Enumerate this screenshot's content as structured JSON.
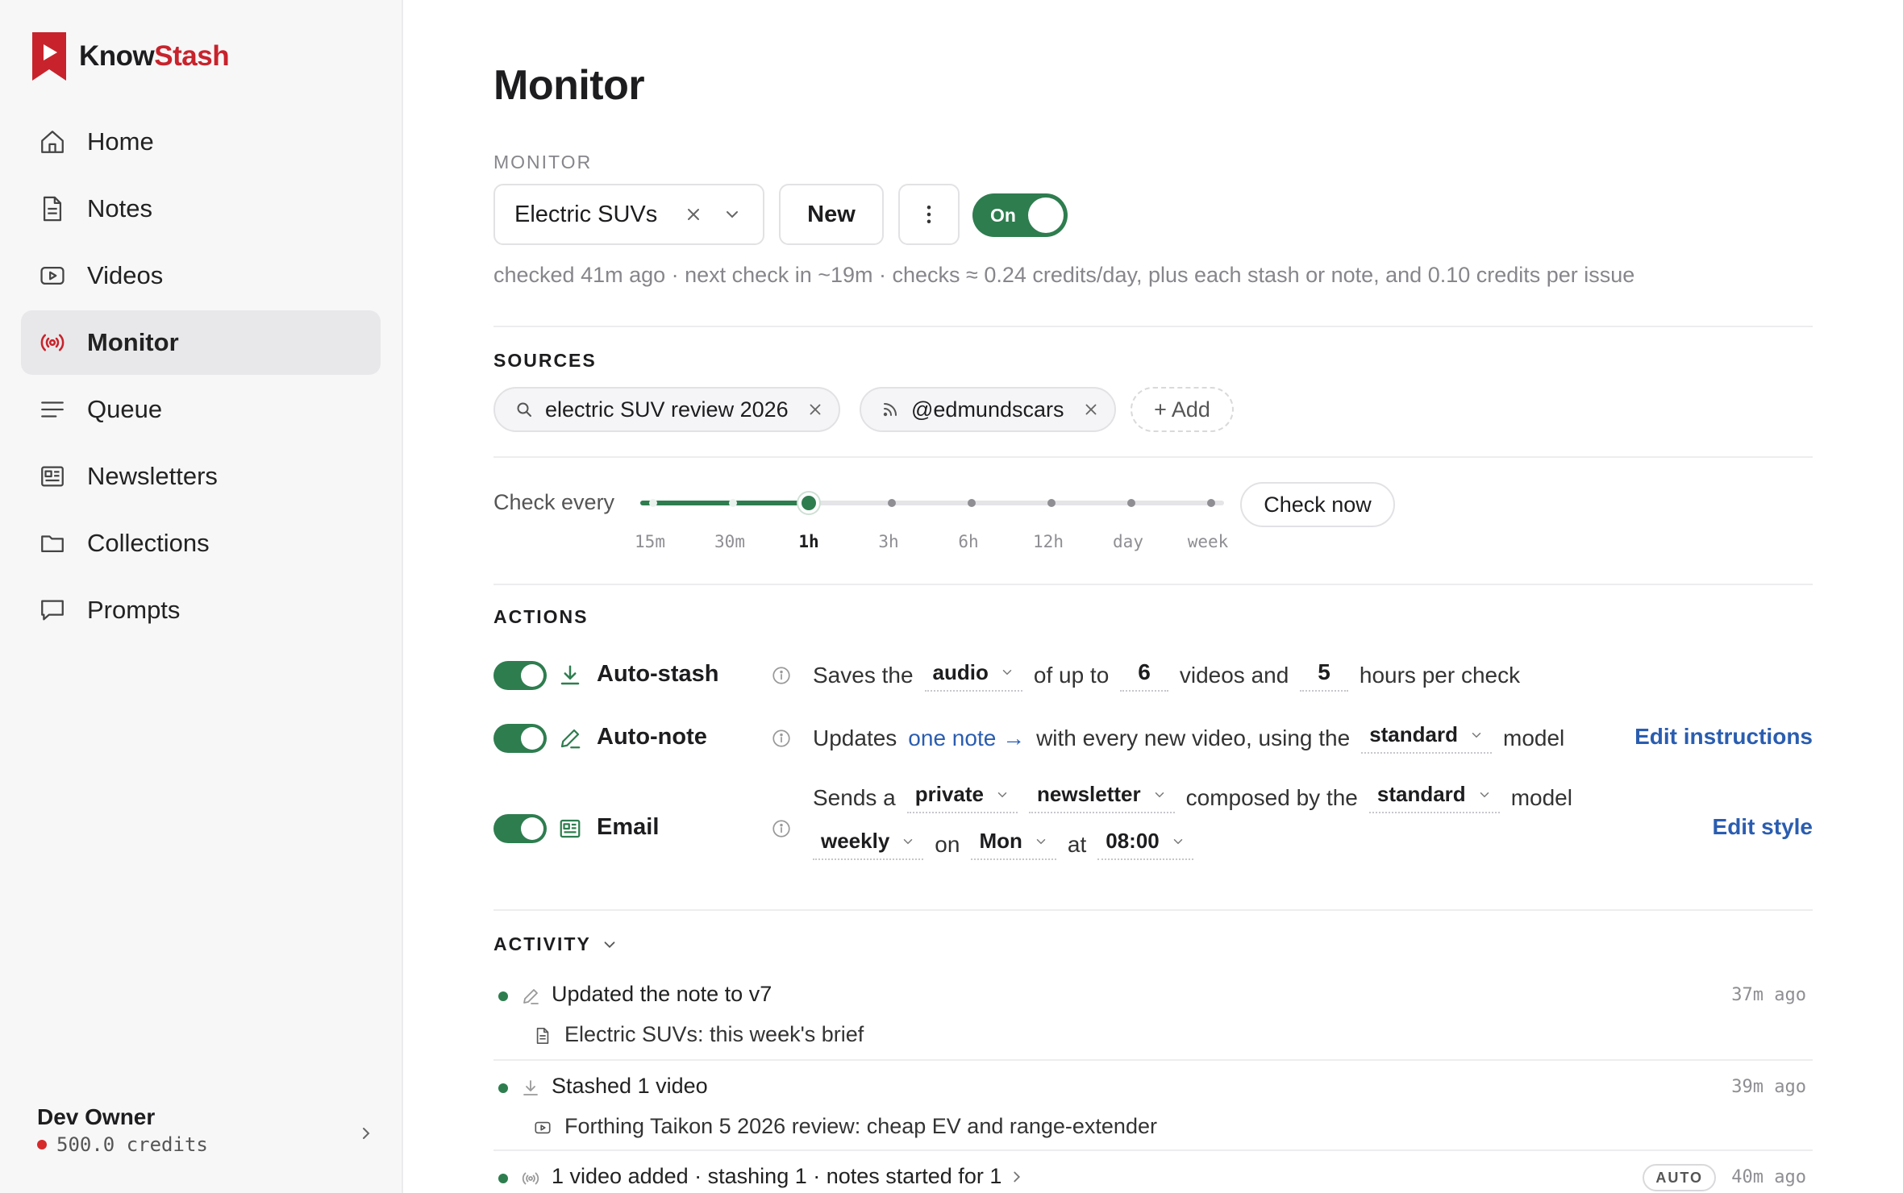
{
  "brand": {
    "name_part1": "Know",
    "name_part2": "Stash",
    "accent": "#c8232c"
  },
  "sidebar": {
    "items": [
      {
        "label": "Home",
        "icon": "home-icon"
      },
      {
        "label": "Notes",
        "icon": "document-icon"
      },
      {
        "label": "Videos",
        "icon": "video-icon"
      },
      {
        "label": "Monitor",
        "icon": "broadcast-icon",
        "active": true
      },
      {
        "label": "Queue",
        "icon": "list-icon"
      },
      {
        "label": "Newsletters",
        "icon": "newspaper-icon"
      },
      {
        "label": "Collections",
        "icon": "folder-icon"
      },
      {
        "label": "Prompts",
        "icon": "chat-icon"
      }
    ],
    "account": {
      "name": "Dev Owner",
      "credits": "500.0 credits"
    }
  },
  "main": {
    "title": "Monitor",
    "monitor_label": "MONITOR",
    "monitor_select": "Electric SUVs",
    "new_button": "New",
    "toggle_label": "On",
    "check_info": "checked 41m ago · next check in ~19m · checks ≈ 0.24 credits/day, plus each stash or note, and 0.10 credits per issue",
    "sources_label": "SOURCES",
    "sources": [
      {
        "label": "electric SUV review 2026",
        "icon": "search-icon"
      },
      {
        "label": "@edmundscars",
        "icon": "rss-icon"
      }
    ],
    "add_source": "+ Add",
    "check_every_label": "Check every",
    "intervals": [
      "15m",
      "30m",
      "1h",
      "3h",
      "6h",
      "12h",
      "day",
      "week"
    ],
    "selected_interval": "1h",
    "check_now": "Check now",
    "actions_label": "ACTIONS",
    "autostash": {
      "name": "Auto-stash",
      "t1": "Saves the",
      "media": "audio",
      "t2": "of up to",
      "videos": "6",
      "t3": "videos and",
      "hours": "5",
      "t4": "hours per check"
    },
    "autonote": {
      "name": "Auto-note",
      "t1": "Updates",
      "link": "one note →",
      "t2": "with every new video, using the",
      "model": "standard",
      "t3": "model",
      "edit": "Edit instructions"
    },
    "email": {
      "name": "Email",
      "t1": "Sends a",
      "privacy": "private",
      "kind": "newsletter",
      "t2": "composed by the",
      "model": "standard",
      "t3": "model",
      "frequency": "weekly",
      "t4": "on",
      "day": "Mon",
      "t5": "at",
      "time": "08:00",
      "edit": "Edit style"
    },
    "activity_label": "ACTIVITY",
    "activity": [
      {
        "text": "Updated the note to v7",
        "icon": "pencil-icon",
        "sub": "Electric SUVs: this week's brief",
        "sub_icon": "document-icon",
        "time": "37m ago"
      },
      {
        "text": "Stashed 1 video",
        "icon": "download-icon",
        "sub": "Forthing Taikon 5 2026 review: cheap EV and range-extender",
        "sub_icon": "video-icon",
        "time": "39m ago"
      },
      {
        "text": "1 video added · stashing 1 · notes started for 1",
        "icon": "broadcast-icon",
        "badge": "AUTO",
        "time": "40m ago"
      }
    ]
  }
}
